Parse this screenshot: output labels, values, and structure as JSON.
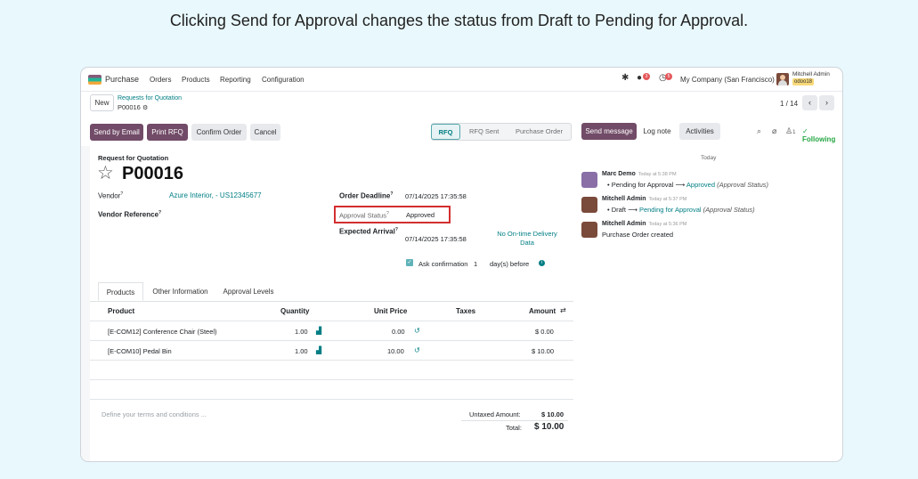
{
  "caption": "Clicking Send for Approval changes the status from Draft to Pending for Approval.",
  "topbar": {
    "app_name": "Purchase",
    "menu": [
      "Orders",
      "Products",
      "Reporting",
      "Configuration"
    ],
    "messages_badge": "3",
    "activities_badge": "5",
    "company": "My Company (San Francisco)",
    "user_name": "Mitchell Admin",
    "db_name": "odoo18"
  },
  "control": {
    "new_label": "New",
    "breadcrumb_parent": "Requests for Quotation",
    "breadcrumb_current": "P00016",
    "pager": "1 / 14",
    "prev_icon": "chevron-left-icon",
    "next_icon": "chevron-right-icon"
  },
  "actions": {
    "send_email": "Send by Email",
    "print_rfq": "Print RFQ",
    "confirm_order": "Confirm Order",
    "cancel": "Cancel"
  },
  "status_stages": [
    "RFQ",
    "RFQ Sent",
    "Purchase Order"
  ],
  "active_stage": "RFQ",
  "chatter_buttons": {
    "send_message": "Send message",
    "log_note": "Log note",
    "activities": "Activities",
    "followers_count": "1",
    "following": "Following"
  },
  "form": {
    "doc_type": "Request for Quotation",
    "name": "P00016",
    "vendor_label": "Vendor",
    "vendor_value": "Azure Interior, - US12345677",
    "vendor_ref_label": "Vendor Reference",
    "order_deadline_label": "Order Deadline",
    "order_deadline_value": "07/14/2025 17:35:58",
    "approval_status_label": "Approval Status",
    "approval_status_value": "Approved",
    "expected_arrival_label": "Expected Arrival",
    "expected_arrival_value": "07/14/2025 17:35:58",
    "no_delivery_line1": "No On-time Delivery",
    "no_delivery_line2": "Data",
    "ask_confirmation_label": "Ask confirmation",
    "ask_confirmation_days": "1",
    "days_before": "day(s) before"
  },
  "tabs": [
    "Products",
    "Other Information",
    "Approval Levels"
  ],
  "table": {
    "headers": [
      "Product",
      "Quantity",
      "Unit Price",
      "Taxes",
      "Amount"
    ],
    "rows": [
      {
        "product": "[E-COM12] Conference Chair (Steel)",
        "quantity": "1.00",
        "unit_price": "0.00",
        "taxes": "",
        "amount": "$ 0.00"
      },
      {
        "product": "[E-COM10] Pedal Bin",
        "quantity": "1.00",
        "unit_price": "10.00",
        "taxes": "",
        "amount": "$ 10.00"
      }
    ]
  },
  "footer": {
    "terms_placeholder": "Define your terms and conditions ...",
    "untaxed_label": "Untaxed Amount:",
    "untaxed_value": "$ 10.00",
    "total_label": "Total:",
    "total_value": "$ 10.00"
  },
  "chatter": {
    "today": "Today",
    "messages": [
      {
        "author": "Marc Demo",
        "date": "Today at 5:38 PM",
        "old": "Pending for Approval",
        "new": "Approved",
        "field": "(Approval Status)"
      },
      {
        "author": "Mitchell Admin",
        "date": "Today at 5:37 PM",
        "old": "Draft",
        "new": "Pending for Approval",
        "field": "(Approval Status)"
      },
      {
        "author": "Mitchell Admin",
        "date": "Today at 5:36 PM",
        "body": "Purchase Order created"
      }
    ],
    "arrow": "⟶"
  },
  "colors": {
    "brand": "#714b67",
    "accent": "#017e84",
    "highlight": "#d32f2f"
  }
}
